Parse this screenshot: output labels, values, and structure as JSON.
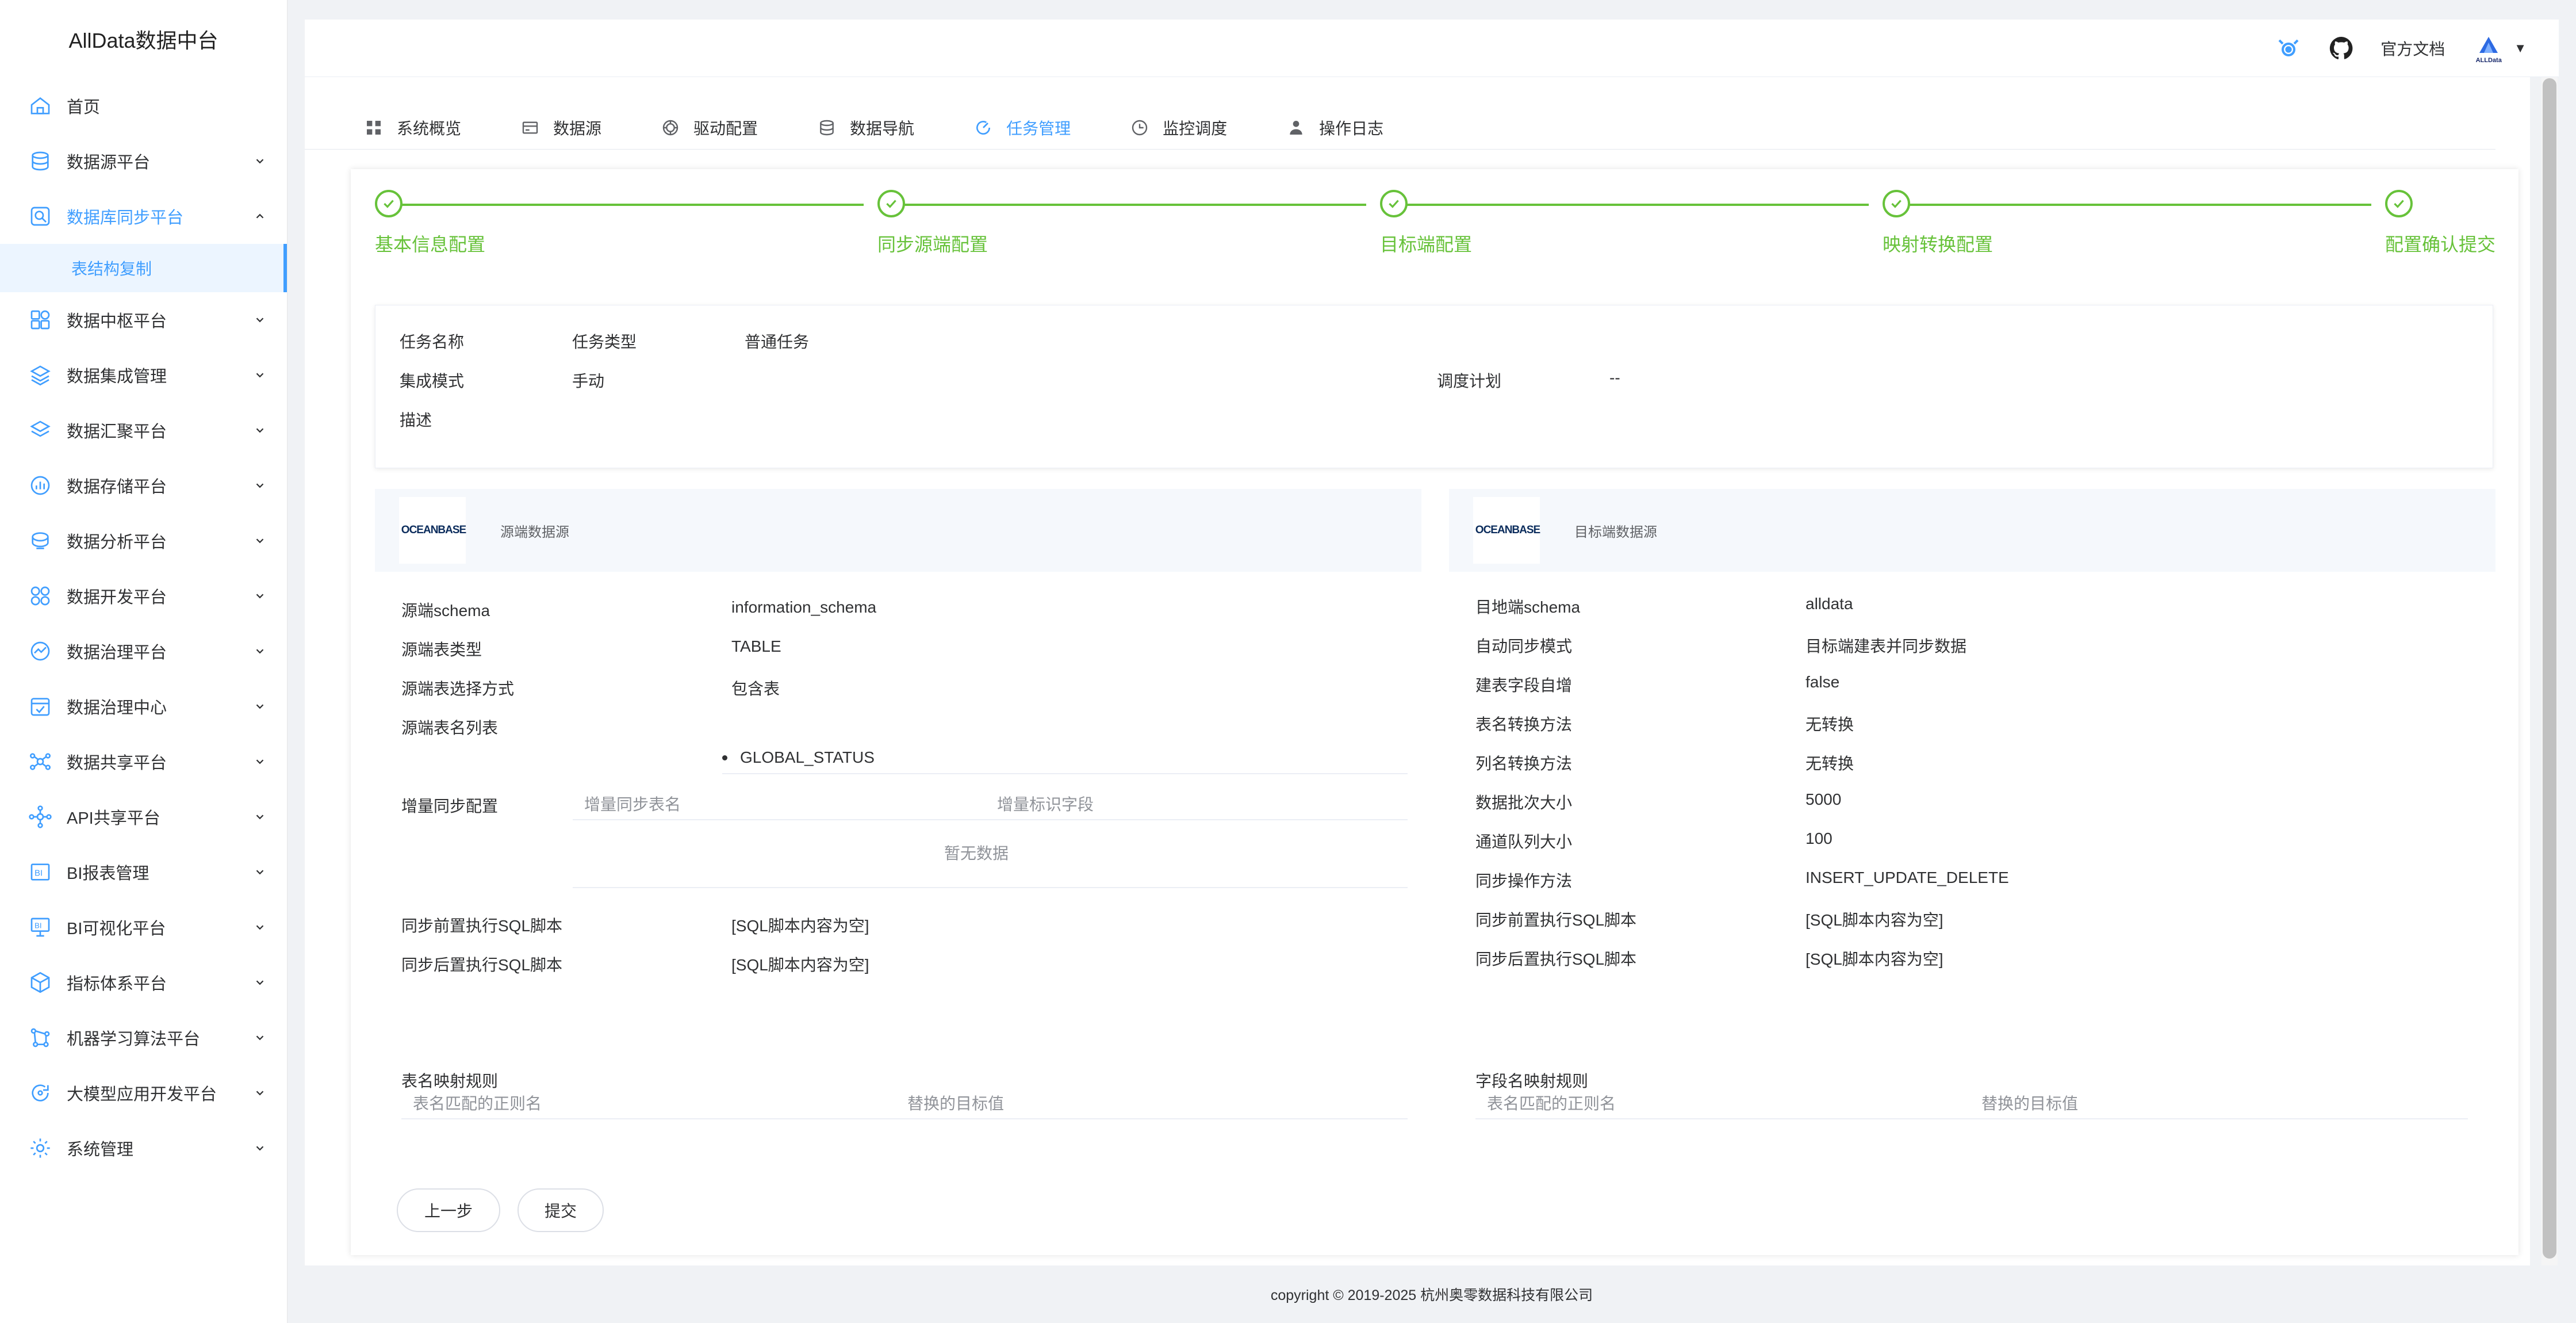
{
  "app": {
    "title": "AllData数据中台"
  },
  "sidebar": {
    "items": [
      {
        "label": "首页",
        "icon": "home-icon"
      },
      {
        "label": "数据源平台",
        "icon": "database-icon"
      },
      {
        "label": "数据库同步平台",
        "icon": "sync-icon"
      },
      {
        "label": "表结构复制"
      },
      {
        "label": "数据中枢平台",
        "icon": "hub-icon"
      },
      {
        "label": "数据集成管理",
        "icon": "layers-icon"
      },
      {
        "label": "数据汇聚平台",
        "icon": "layers-icon"
      },
      {
        "label": "数据存储平台",
        "icon": "chart-icon"
      },
      {
        "label": "数据分析平台",
        "icon": "analysis-icon"
      },
      {
        "label": "数据开发平台",
        "icon": "dev-icon"
      },
      {
        "label": "数据治理平台",
        "icon": "governance-icon"
      },
      {
        "label": "数据治理中心",
        "icon": "check-icon"
      },
      {
        "label": "数据共享平台",
        "icon": "share-icon"
      },
      {
        "label": "API共享平台",
        "icon": "api-icon"
      },
      {
        "label": "BI报表管理",
        "icon": "bi-icon"
      },
      {
        "label": "BI可视化平台",
        "icon": "monitor-icon"
      },
      {
        "label": "指标体系平台",
        "icon": "box-icon"
      },
      {
        "label": "机器学习算法平台",
        "icon": "ml-icon"
      },
      {
        "label": "大模型应用开发平台",
        "icon": "llm-icon"
      },
      {
        "label": "系统管理",
        "icon": "gear-icon"
      }
    ]
  },
  "header": {
    "docs": "官方文档",
    "logo_text": "ALLData"
  },
  "nav": {
    "tabs": [
      "系统概览",
      "数据源",
      "驱动配置",
      "数据导航",
      "任务管理",
      "监控调度",
      "操作日志"
    ]
  },
  "steps": [
    "基本信息配置",
    "同步源端配置",
    "目标端配置",
    "映射转换配置",
    "配置确认提交"
  ],
  "info": {
    "task_name_label": "任务名称",
    "task_type_label": "任务类型",
    "task_type_value": "普通任务",
    "mode_label": "集成模式",
    "mode_value": "手动",
    "schedule_label": "调度计划",
    "schedule_value": "--",
    "desc_label": "描述"
  },
  "source": {
    "logo": "OCEANBASE",
    "title": "源端数据源",
    "schema_label": "源端schema",
    "schema_value": "information_schema",
    "type_label": "源端表类型",
    "type_value": "TABLE",
    "select_label": "源端表选择方式",
    "select_value": "包含表",
    "tables_label": "源端表名列表",
    "tables": [
      "GLOBAL_STATUS"
    ],
    "incr_label": "增量同步配置",
    "incr_col1": "增量同步表名",
    "incr_col2": "增量标识字段",
    "incr_empty": "暂无数据",
    "pre_sql_label": "同步前置执行SQL脚本",
    "pre_sql_value": "[SQL脚本内容为空]",
    "post_sql_label": "同步后置执行SQL脚本",
    "post_sql_value": "[SQL脚本内容为空]",
    "map_label": "表名映射规则",
    "map_col1": "表名匹配的正则名",
    "map_col2": "替换的目标值"
  },
  "target": {
    "logo": "OCEANBASE",
    "title": "目标端数据源",
    "rows": [
      {
        "label": "目地端schema",
        "value": "alldata"
      },
      {
        "label": "自动同步模式",
        "value": "目标端建表并同步数据"
      },
      {
        "label": "建表字段自增",
        "value": "false"
      },
      {
        "label": "表名转换方法",
        "value": "无转换"
      },
      {
        "label": "列名转换方法",
        "value": "无转换"
      },
      {
        "label": "数据批次大小",
        "value": "5000"
      },
      {
        "label": "通道队列大小",
        "value": "100"
      },
      {
        "label": "同步操作方法",
        "value": "INSERT_UPDATE_DELETE"
      },
      {
        "label": "同步前置执行SQL脚本",
        "value": "[SQL脚本内容为空]"
      },
      {
        "label": "同步后置执行SQL脚本",
        "value": "[SQL脚本内容为空]"
      }
    ],
    "map_label": "字段名映射规则",
    "map_col1": "表名匹配的正则名",
    "map_col2": "替换的目标值"
  },
  "buttons": {
    "prev": "上一步",
    "submit": "提交"
  },
  "footer": "copyright © 2019-2025 杭州奥零数据科技有限公司",
  "colors": {
    "accent": "#409eff",
    "success": "#67c23a"
  }
}
